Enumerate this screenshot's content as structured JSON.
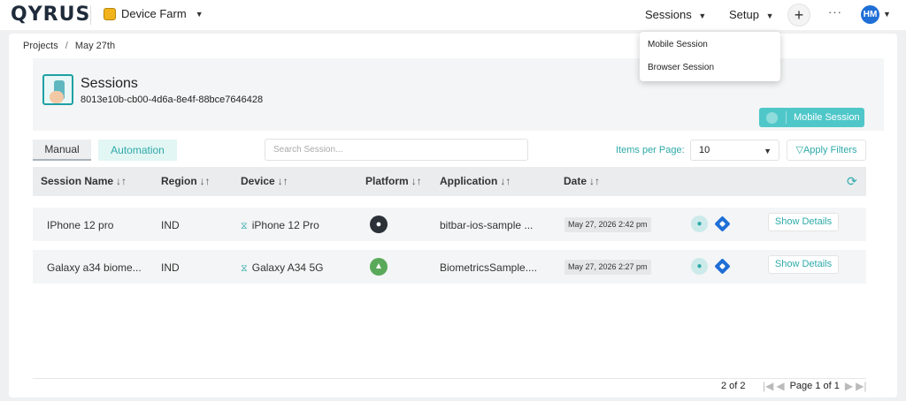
{
  "topbar": {
    "logo": "QYRUS",
    "workspace": "Device Farm",
    "nav_sessions": "Sessions",
    "nav_setup": "Setup",
    "more": "···",
    "avatar_initials": "HM"
  },
  "breadcrumb": {
    "root": "Projects",
    "separator": "/",
    "current": "May 27th"
  },
  "session": {
    "title": "Sessions",
    "id": "8013e10b-cb00-4d6a-8e4f-88bce7646428",
    "new_button": "Mobile Session"
  },
  "tabs": [
    {
      "label": "Manual",
      "active": true
    },
    {
      "label": "Automation",
      "active": false
    }
  ],
  "search": {
    "placeholder": "Search Session..."
  },
  "pagination": {
    "items_per_page_label": "Items per Page:",
    "items_per_page": "10",
    "apply_filters": "Apply Filters",
    "count": "2 of 2",
    "page": "Page 1 of 1"
  },
  "table": {
    "columns": [
      "Session Name",
      "Region",
      "Device",
      "Platform",
      "Application",
      "Date"
    ],
    "rows": [
      {
        "name": "IPhone 12 pro",
        "region": "IND",
        "device": "iPhone 12 Pro",
        "platform": "ios",
        "application": "bitbar-ios-sample ...",
        "date": "May 27, 2026 2:42 pm",
        "details": "Show Details"
      },
      {
        "name": "Galaxy a34 biome...",
        "region": "IND",
        "device": "Galaxy A34 5G",
        "platform": "android",
        "application": "BiometricsSample....",
        "date": "May 27, 2026 2:27 pm",
        "details": "Show Details"
      }
    ]
  },
  "sessions_menu": {
    "items": [
      "Mobile Session",
      "Browser Session"
    ]
  },
  "colors": {
    "accent": "#2fa9a9",
    "button": "#4fc7c9",
    "avatar": "#1f6fd6"
  },
  "icons": [
    "device-farm-icon",
    "caret-down-icon",
    "plus-icon",
    "avatar",
    "session-icon",
    "plus-circle-icon",
    "filter-icon",
    "sort-icon",
    "refresh-icon",
    "device-icon",
    "apple-icon",
    "android-icon",
    "user-icon",
    "jira-icon",
    "first-page-icon",
    "prev-page-icon",
    "next-page-icon",
    "last-page-icon"
  ]
}
